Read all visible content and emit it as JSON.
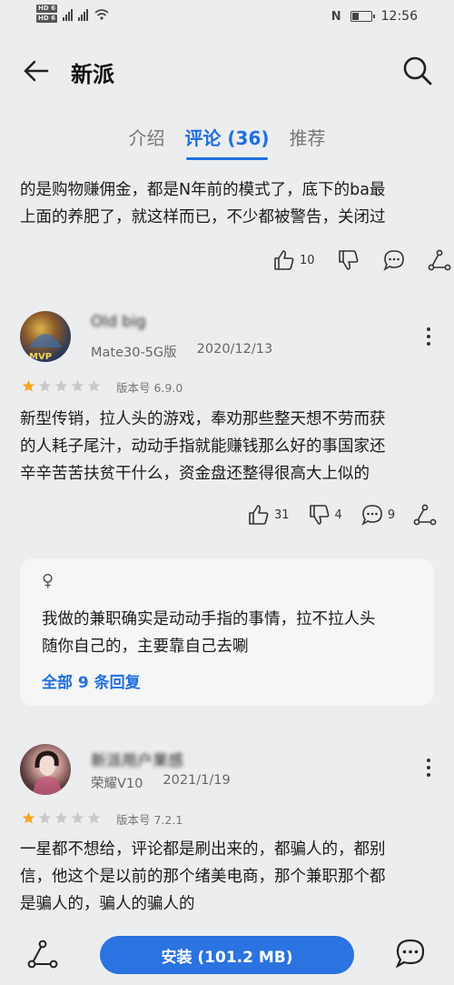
{
  "status": {
    "sim1": "HD 6",
    "sim2": "HD 6",
    "time": "12:56",
    "battery_level": 0.35
  },
  "header": {
    "title": "新派",
    "back_icon": "back-arrow-icon",
    "search_icon": "search-icon"
  },
  "tabs": [
    {
      "label": "介绍",
      "active": false
    },
    {
      "label": "评论 (36)",
      "active": true
    },
    {
      "label": "推荐",
      "active": false
    }
  ],
  "top_review": {
    "text_line1": "的是购物赚佣金，都是N年前的模式了，底下的ba最",
    "text_line2": "上面的养肥了，就这样而已，不少都被警告，关闭过",
    "likes": "10"
  },
  "review1": {
    "username": "Old big",
    "device": "Mate30-5G版",
    "date": "2020/12/13",
    "rating": 1,
    "version": "版本号 6.9.0",
    "text_line1": "新型传销，拉人头的游戏，奉劝那些整天想不劳而获",
    "text_line2": "的人耗子尾汁，动动手指就能赚钱那么好的事国家还",
    "text_line3": "辛辛苦苦扶贫干什么，资金盘还整得很高大上似的",
    "likes": "31",
    "dislikes": "4",
    "comments": "9",
    "reply": {
      "gender": "♀",
      "text_line1": "我做的兼职确实是动动手指的事情，拉不拉人头",
      "text_line2": "随你自己的，主要靠自己去唰",
      "link": "全部 9 条回复"
    }
  },
  "review2": {
    "username": "新派用户果感",
    "device": "荣耀V10",
    "date": "2021/1/19",
    "rating": 1,
    "version": "版本号 7.2.1",
    "text_line1": "一星都不想给，评论都是刷出来的，都骗人的，都别",
    "text_line2": "信，他这个是以前的那个绪美电商，那个兼职那个都",
    "text_line3": "是骗人的，骗人的骗人的"
  },
  "bottom": {
    "install_label": "安装 (101.2 MB)"
  },
  "colors": {
    "accent": "#1f6fe0",
    "background": "#ecedef",
    "star_filled": "#f5a623",
    "star_empty": "#c9c9c9"
  }
}
